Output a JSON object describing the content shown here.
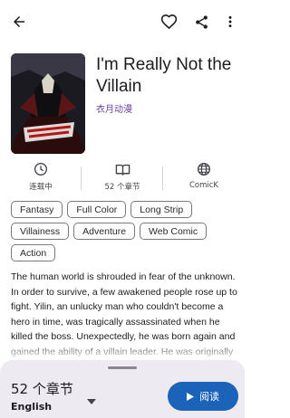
{
  "manga": {
    "title": "I'm Really Not the Villain",
    "author": "衣月动漫"
  },
  "stats": {
    "status": "连载中",
    "chapters": "52 个章节",
    "source": "ComicK"
  },
  "tags": [
    "Fantasy",
    "Full Color",
    "Long Strip",
    "Villainess",
    "Adventure",
    "Web Comic",
    "Action"
  ],
  "description": "The human world is shrouded in fear of the unknown. In order to survive, a few awakened people rose up to fight. Yilin, an unlucky man who couldn't become a hero in time, was tragically assassinated when he killed the boss. Unexpectedly, he was born again and gained the ability of a villain leader. He was originally an ordinary man but he became the",
  "bottom_bar": {
    "chapter_count": "52 个章节",
    "language": "English",
    "read_label": "阅读"
  },
  "colors": {
    "accent": "#1a63b8",
    "author": "#6a3fa3",
    "sheet": "#edeaf2"
  }
}
